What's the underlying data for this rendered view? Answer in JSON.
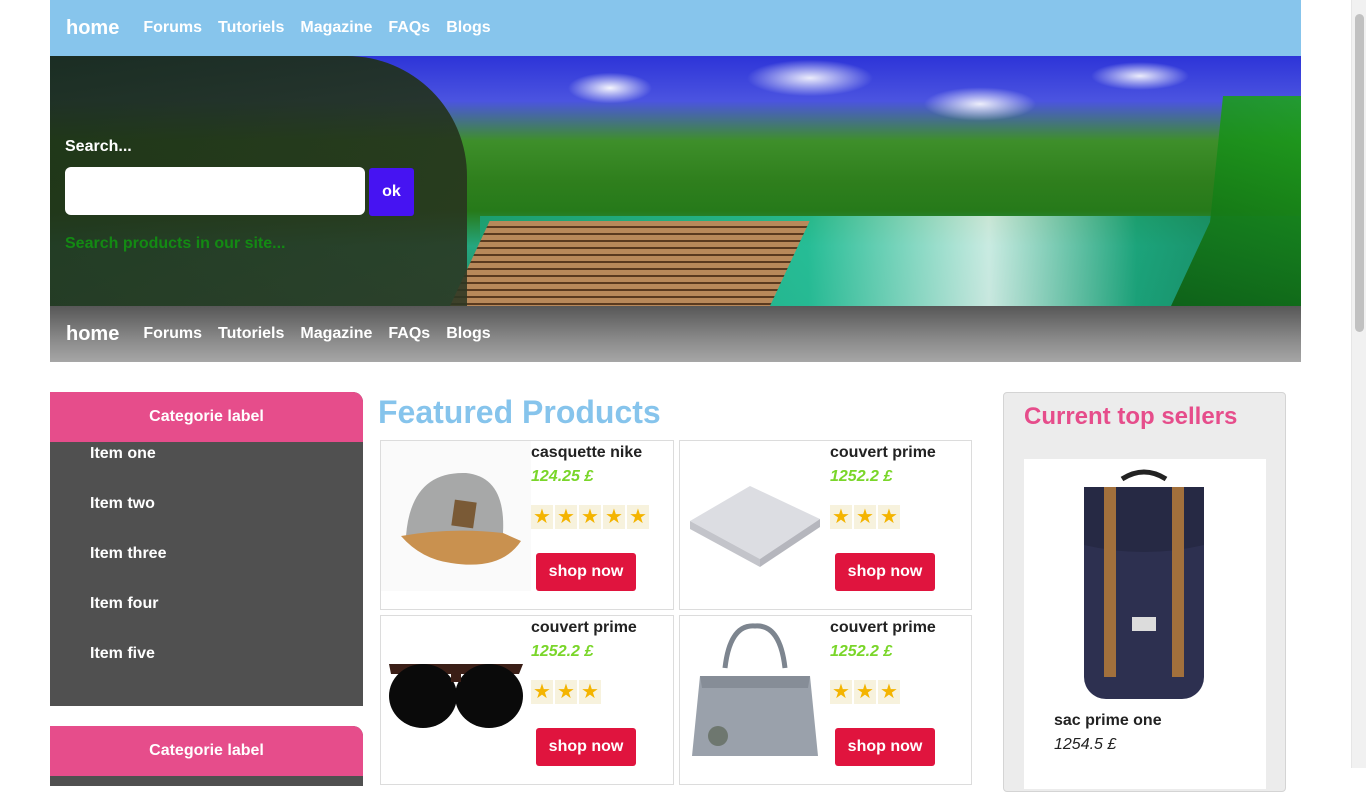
{
  "nav": {
    "brand": "home",
    "links": [
      "Forums",
      "Tutoriels",
      "Magazine",
      "FAQs",
      "Blogs"
    ]
  },
  "search": {
    "label": "Search...",
    "value": "",
    "button": "ok",
    "hint": "Search products in our site..."
  },
  "categories": [
    {
      "label": "Categorie label",
      "items": [
        "Item one",
        "Item two",
        "Item three",
        "Item four",
        "Item five"
      ]
    },
    {
      "label": "Categorie label",
      "items": []
    }
  ],
  "featured": {
    "title": "Featured Products",
    "products": [
      {
        "name": "casquette nike",
        "price": "124.25 £",
        "rating": 5,
        "button": "shop now",
        "image_icon": "cap-icon"
      },
      {
        "name": "couvert prime",
        "price": "1252.2 £",
        "rating": 3,
        "button": "shop now",
        "image_icon": "blanket-icon"
      },
      {
        "name": "couvert prime",
        "price": "1252.2 £",
        "rating": 3,
        "button": "shop now",
        "image_icon": "sunglasses-icon"
      },
      {
        "name": "couvert prime",
        "price": "1252.2 £",
        "rating": 3,
        "button": "shop now",
        "image_icon": "handbag-icon"
      }
    ]
  },
  "top_sellers": {
    "title": "Current top sellers",
    "items": [
      {
        "name": "sac prime one",
        "price": "1254.5 £",
        "image_icon": "backpack-icon"
      }
    ]
  },
  "colors": {
    "nav_top": "#87c5ec",
    "accent_pink": "#e64d8b",
    "shop_button": "#e0143e",
    "search_button": "#4613f2",
    "price_green": "#7ad62a",
    "featured_title": "#86c4ec"
  }
}
